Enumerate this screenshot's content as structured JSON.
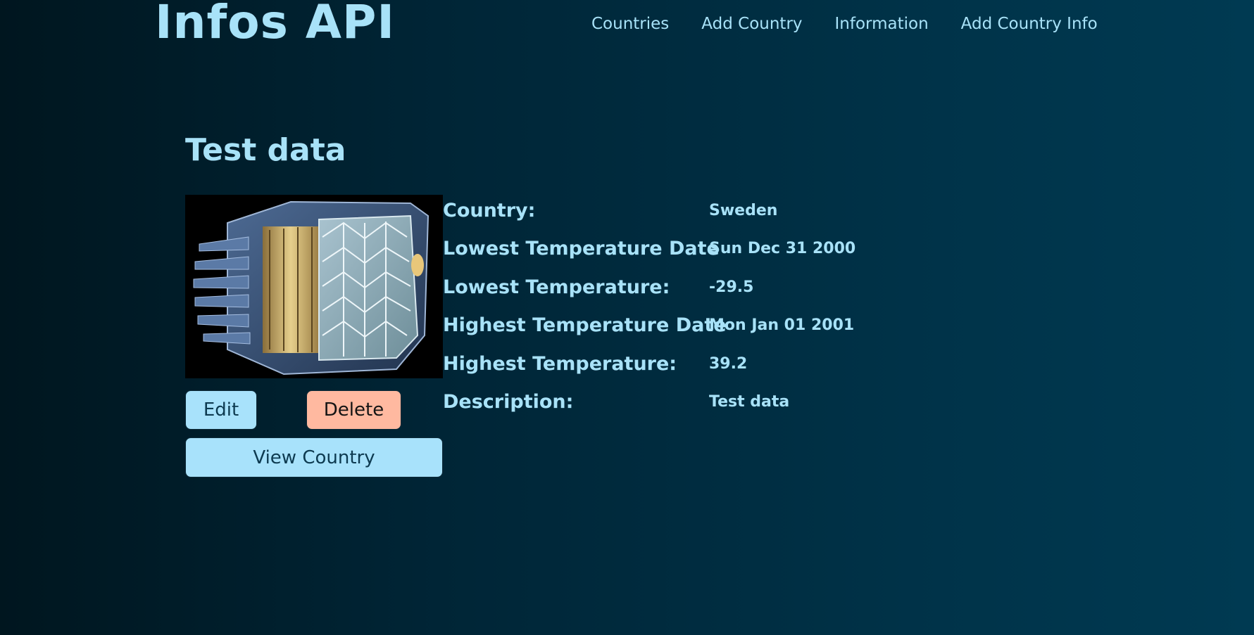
{
  "brand": "Infos API",
  "nav": {
    "countries": "Countries",
    "add_country": "Add Country",
    "information": "Information",
    "add_country_info": "Add Country Info"
  },
  "page": {
    "title": "Test data"
  },
  "image": {
    "icon": "satellite-engine-image"
  },
  "buttons": {
    "edit": "Edit",
    "delete": "Delete",
    "view_country": "View Country"
  },
  "info": [
    {
      "label": "Country:",
      "value": "Sweden"
    },
    {
      "label": "Lowest Temperature Date",
      "value": "Sun Dec 31 2000"
    },
    {
      "label": "Lowest Temperature:",
      "value": "-29.5"
    },
    {
      "label": "Highest Temperature Date",
      "value": "Mon Jan 01 2001"
    },
    {
      "label": "Highest Temperature:",
      "value": "39.2"
    },
    {
      "label": "Description:",
      "value": "Test data"
    }
  ],
  "colors": {
    "accent": "#a8e2f8",
    "button_primary": "#a8e2fb",
    "button_danger": "#ffb9a0",
    "background": "#002536"
  }
}
